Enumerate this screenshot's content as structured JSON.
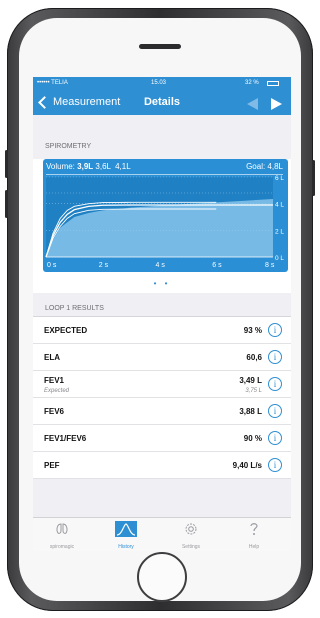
{
  "colors": {
    "accent": "#2f8fd3",
    "chart_bg": "#2a8fd4"
  },
  "statusbar": {
    "carrier": "•••••• TELIA",
    "time": "15.03",
    "battery": "32 %"
  },
  "navbar": {
    "back_label": "Measurement",
    "title": "Details",
    "prev_icon": "triangle-left-icon",
    "next_icon": "triangle-right-icon"
  },
  "spirometry": {
    "header": "SPIROMETRY",
    "volume_label": "Volume:",
    "volume_main": "3,9L",
    "volume_others": "3,6L  4,1L",
    "goal_label": "Goal: 4,8L",
    "page_dots": "• •"
  },
  "chart_data": {
    "type": "area",
    "x_ticks": [
      "0 s",
      "2 s",
      "4 s",
      "6 s",
      "8 s"
    ],
    "y_ticks": [
      "0 L",
      "2 L",
      "4 L",
      "6 L"
    ],
    "xlim": [
      0,
      8
    ],
    "ylim": [
      0,
      6
    ],
    "goal_line": 4.8,
    "series": [
      {
        "values_x": [
          0,
          0.25,
          0.5,
          0.75,
          1,
          1.5,
          2,
          3,
          4,
          5,
          6,
          7,
          8
        ],
        "values_y": [
          0,
          1.6,
          2.6,
          3.2,
          3.55,
          3.8,
          3.88,
          3.9,
          3.9,
          3.9,
          3.9,
          3.9,
          3.9
        ]
      },
      {
        "values_x": [
          0,
          0.25,
          0.5,
          0.75,
          1,
          1.5,
          2,
          3,
          4,
          5,
          6
        ],
        "values_y": [
          0,
          1.4,
          2.3,
          2.9,
          3.25,
          3.5,
          3.58,
          3.6,
          3.6,
          3.6,
          3.6
        ]
      },
      {
        "values_x": [
          0,
          0.25,
          0.5,
          0.75,
          1,
          1.5,
          2,
          3,
          4,
          5,
          6
        ],
        "values_y": [
          0,
          1.8,
          2.9,
          3.5,
          3.8,
          4.0,
          4.08,
          4.1,
          4.1,
          4.1,
          4.1
        ]
      }
    ],
    "expected_area": {
      "values_x": [
        0,
        0.25,
        0.5,
        1,
        1.5,
        2,
        3,
        4,
        5,
        6,
        7,
        8
      ],
      "values_y": [
        0,
        1.3,
        2.2,
        3.0,
        3.3,
        3.5,
        3.7,
        3.85,
        3.98,
        4.1,
        4.22,
        4.35
      ]
    }
  },
  "results": {
    "header": "LOOP 1 RESULTS",
    "rows": [
      {
        "label": "EXPECTED",
        "sub": "",
        "value": "93 %",
        "value_sub": ""
      },
      {
        "label": "ELA",
        "sub": "",
        "value": "60,6",
        "value_sub": ""
      },
      {
        "label": "FEV1",
        "sub": "Expected",
        "value": "3,49 L",
        "value_sub": "3,75 L"
      },
      {
        "label": "FEV6",
        "sub": "",
        "value": "3,88 L",
        "value_sub": ""
      },
      {
        "label": "FEV1/FEV6",
        "sub": "",
        "value": "90 %",
        "value_sub": ""
      },
      {
        "label": "PEF",
        "sub": "",
        "value": "9,40 L/s",
        "value_sub": ""
      }
    ],
    "info_glyph": "i"
  },
  "tabbar": {
    "tabs": [
      {
        "label": "spiromagic",
        "icon": "lungs-icon"
      },
      {
        "label": "History",
        "icon": "chart-icon",
        "active": true
      },
      {
        "label": "Settings",
        "icon": "gear-icon"
      },
      {
        "label": "Help",
        "icon": "question-icon"
      }
    ]
  }
}
